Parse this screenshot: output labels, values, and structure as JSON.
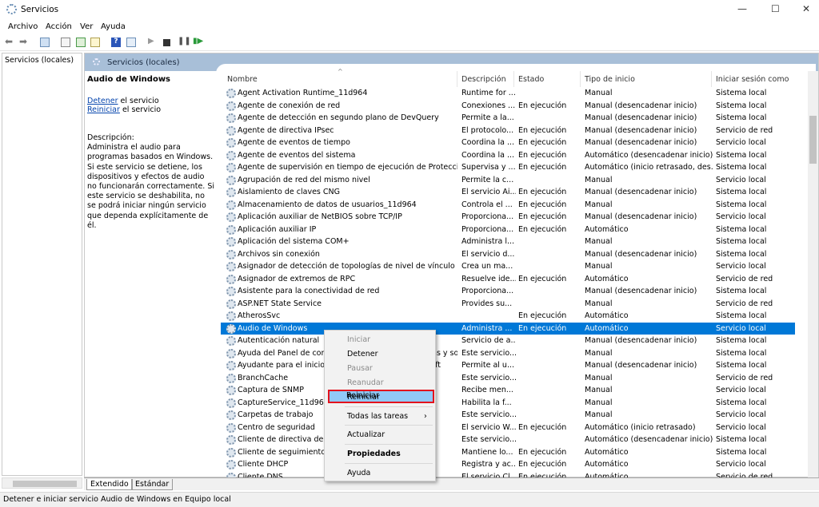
{
  "window": {
    "title": "Servicios",
    "minimize": "—",
    "maximize": "☐",
    "close": "✕"
  },
  "menubar": [
    "Archivo",
    "Acción",
    "Ver",
    "Ayuda"
  ],
  "toolbar": [
    "back-icon",
    "forward-icon",
    "console-tree-icon",
    "properties-icon",
    "refresh-icon",
    "export-icon",
    "help-icon",
    "view-icon",
    "start-icon",
    "stop-icon",
    "pause-icon",
    "restart-icon"
  ],
  "tree": {
    "root": "Servicios (locales)"
  },
  "header": {
    "title": "Servicios (locales)"
  },
  "details": {
    "service": "Audio de Windows",
    "stop_link": "Detener",
    "stop_rest": " el servicio",
    "restart_link": "Reiniciar",
    "restart_rest": " el servicio",
    "description": "Descripción:\nAdministra el audio para programas basados en Windows. Si este servicio se detiene, los dispositivos y efectos de audio no funcionarán correctamente. Si este servicio se deshabilita, no se podrá iniciar ningún servicio que dependa explícitamente de él."
  },
  "columns": [
    "Nombre",
    "Descripción",
    "Estado",
    "Tipo de inicio",
    "Iniciar sesión como"
  ],
  "rows": [
    [
      "Agent Activation Runtime_11d964",
      "Runtime for ...",
      "",
      "Manual",
      "Sistema local"
    ],
    [
      "Agente de conexión de red",
      "Conexiones ...",
      "En ejecución",
      "Manual (desencadenar inicio)",
      "Sistema local"
    ],
    [
      "Agente de detección en segundo plano de DevQuery",
      "Permite a la...",
      "",
      "Manual (desencadenar inicio)",
      "Sistema local"
    ],
    [
      "Agente de directiva IPsec",
      "El protocolo...",
      "En ejecución",
      "Manual (desencadenar inicio)",
      "Servicio de red"
    ],
    [
      "Agente de eventos de tiempo",
      "Coordina la ...",
      "En ejecución",
      "Manual (desencadenar inicio)",
      "Servicio local"
    ],
    [
      "Agente de eventos del sistema",
      "Coordina la ...",
      "En ejecución",
      "Automático (desencadenar inicio)",
      "Sistema local"
    ],
    [
      "Agente de supervisión en tiempo de ejecución de Protección ...",
      "Supervisa y ...",
      "En ejecución",
      "Automático (inicio retrasado, des...",
      "Sistema local"
    ],
    [
      "Agrupación de red del mismo nivel",
      "Permite la c...",
      "",
      "Manual",
      "Servicio local"
    ],
    [
      "Aislamiento de claves CNG",
      "El servicio Ai...",
      "En ejecución",
      "Manual (desencadenar inicio)",
      "Sistema local"
    ],
    [
      "Almacenamiento de datos de usuarios_11d964",
      "Controla el ...",
      "En ejecución",
      "Manual",
      "Sistema local"
    ],
    [
      "Aplicación auxiliar de NetBIOS sobre TCP/IP",
      "Proporciona...",
      "En ejecución",
      "Manual (desencadenar inicio)",
      "Servicio local"
    ],
    [
      "Aplicación auxiliar IP",
      "Proporciona...",
      "En ejecución",
      "Automático",
      "Sistema local"
    ],
    [
      "Aplicación del sistema COM+",
      "Administra l...",
      "",
      "Manual",
      "Sistema local"
    ],
    [
      "Archivos sin conexión",
      "El servicio d...",
      "",
      "Manual (desencadenar inicio)",
      "Sistema local"
    ],
    [
      "Asignador de detección de topologías de nivel de vínculo",
      "Crea un ma...",
      "",
      "Manual",
      "Servicio local"
    ],
    [
      "Asignador de extremos de RPC",
      "Resuelve ide...",
      "En ejecución",
      "Automático",
      "Servicio de red"
    ],
    [
      "Asistente para la conectividad de red",
      "Proporciona...",
      "",
      "Manual (desencadenar inicio)",
      "Sistema local"
    ],
    [
      "ASP.NET State Service",
      "Provides su...",
      "",
      "Manual",
      "Servicio de red"
    ],
    [
      "AtherosSvc",
      "",
      "En ejecución",
      "Automático",
      "Sistema local"
    ],
    [
      "Audio de Windows",
      "Administra ...",
      "En ejecución",
      "Automático",
      "Servicio local"
    ],
    [
      "Autenticación natural",
      "Servicio de a...",
      "",
      "Manual (desencadenar inicio)",
      "Sistema local"
    ],
    [
      "Ayuda del Panel de control de informes de problemas y soluc...",
      "Este servicio...",
      "",
      "Manual",
      "Sistema local"
    ],
    [
      "Ayudante para el inicio de sesión de cuenta Microsoft",
      "Permite al u...",
      "",
      "Manual (desencadenar inicio)",
      "Sistema local"
    ],
    [
      "BranchCache",
      "Este servicio...",
      "",
      "Manual",
      "Servicio de red"
    ],
    [
      "Captura de SNMP",
      "Recibe men...",
      "",
      "Manual",
      "Servicio local"
    ],
    [
      "CaptureService_11d964",
      "Habilita la f...",
      "",
      "Manual",
      "Sistema local"
    ],
    [
      "Carpetas de trabajo",
      "Este servicio...",
      "",
      "Manual",
      "Servicio local"
    ],
    [
      "Centro de seguridad",
      "El servicio W...",
      "En ejecución",
      "Automático (inicio retrasado)",
      "Servicio local"
    ],
    [
      "Cliente de directiva de grupo",
      "Este servicio...",
      "",
      "Automático (desencadenar inicio)",
      "Sistema local"
    ],
    [
      "Cliente de seguimiento de vínculos distribuidos",
      "Mantiene lo...",
      "En ejecución",
      "Automático",
      "Sistema local"
    ],
    [
      "Cliente DHCP",
      "Registra y ac...",
      "En ejecución",
      "Automático",
      "Servicio local"
    ],
    [
      "Cliente DNS",
      "El servicio Cl...",
      "En ejecución",
      "Automático",
      "Servicio de red"
    ]
  ],
  "selected_row": 19,
  "context_menu": [
    {
      "label": "Iniciar",
      "disabled": true
    },
    {
      "label": "Detener",
      "disabled": false
    },
    {
      "label": "Pausar",
      "disabled": true
    },
    {
      "label": "Reanudar",
      "disabled": true
    },
    {
      "label": "Reiniciar",
      "disabled": false,
      "highlighted": true
    },
    {
      "label": "Todas las tareas",
      "disabled": false,
      "submenu": "›"
    },
    {
      "label": "Actualizar",
      "disabled": false
    },
    {
      "label": "Propiedades",
      "disabled": false,
      "bold": true
    },
    {
      "label": "Ayuda",
      "disabled": false
    }
  ],
  "tabs": [
    "Extendido",
    "Estándar"
  ],
  "status": "Detener e iniciar servicio Audio de Windows en Equipo local",
  "colors": {
    "selection": "#0078d7",
    "header": "#a8bfd8",
    "highlight_border": "#e3121d",
    "menu_highlight": "#91c9f7",
    "link": "#0645ad"
  }
}
